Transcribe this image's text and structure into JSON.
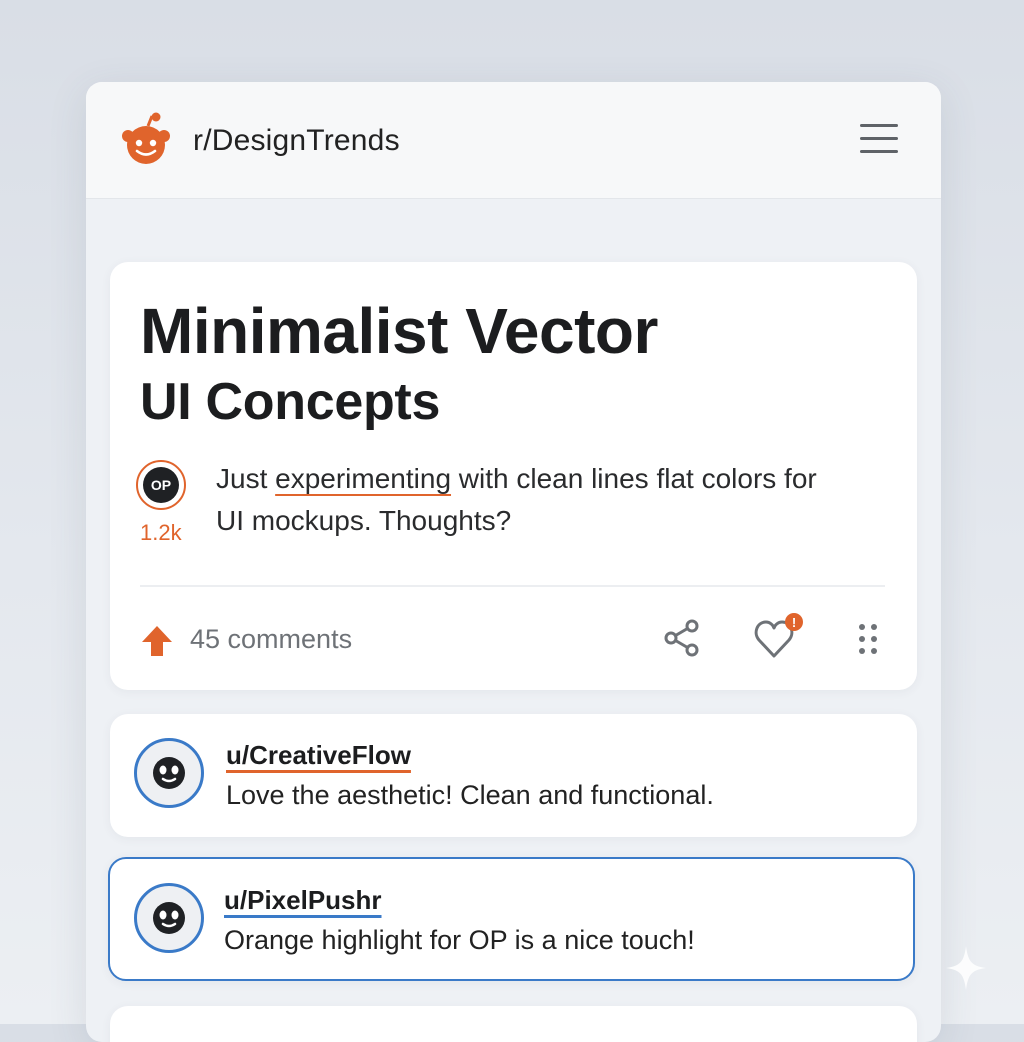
{
  "header": {
    "subreddit": "r/DesignTrends",
    "logo_icon": "reddit-alien-icon",
    "menu_icon": "hamburger-menu-icon"
  },
  "post": {
    "title_line1": "Minimalist Vector",
    "title_line2": "UI Concepts",
    "op_badge": "OP",
    "score": "1.2k",
    "body_before": "Just ",
    "body_highlight": "experimenting",
    "body_after": " with clean lines flat colors for UI mockups. Thoughts?",
    "comments_label": "45 comments",
    "notification_badge": "!",
    "icons": [
      "upvote-arrow-icon",
      "share-icon",
      "heart-icon",
      "more-dots-icon"
    ]
  },
  "comments": [
    {
      "user": "u/CreativeFlow",
      "text": "Love the aesthetic! Clean and functional.",
      "underline_color": "#e0642c"
    },
    {
      "user": "u/PixelPushr",
      "text": "Orange highlight for OP is a nice touch!",
      "underline_color": "#3a7ac8"
    }
  ],
  "colors": {
    "accent_orange": "#e0642c",
    "accent_blue": "#3a7ac8",
    "text_dark": "#1c1d1f",
    "text_muted": "#6e7277"
  }
}
